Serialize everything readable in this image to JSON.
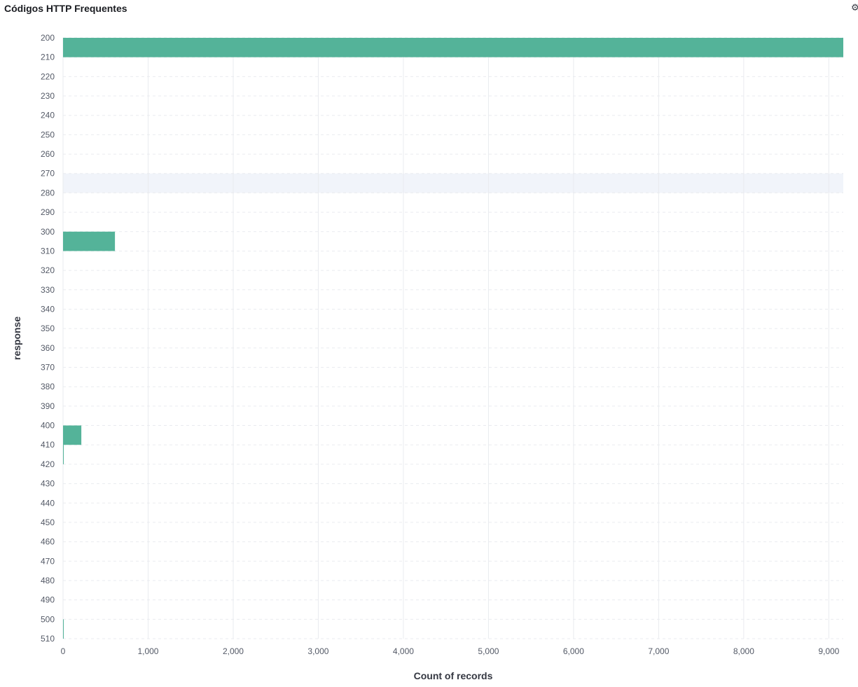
{
  "panel": {
    "title": "Códigos HTTP Frequentes",
    "corner_icon": "gear-icon",
    "corner_glyph": "⚙"
  },
  "chart_data": {
    "type": "bar",
    "orientation": "horizontal",
    "title": "Códigos HTTP Frequentes",
    "xlabel": "Count of records",
    "ylabel": "response",
    "xlim": [
      0,
      9170
    ],
    "ylim": [
      200,
      510
    ],
    "x_ticks": [
      0,
      1000,
      2000,
      3000,
      4000,
      5000,
      6000,
      7000,
      8000,
      9000
    ],
    "x_tick_labels": [
      "0",
      "1,000",
      "2,000",
      "3,000",
      "4,000",
      "5,000",
      "6,000",
      "7,000",
      "8,000",
      "9,000"
    ],
    "y_ticks": [
      200,
      210,
      220,
      230,
      240,
      250,
      260,
      270,
      280,
      290,
      300,
      310,
      320,
      330,
      340,
      350,
      360,
      370,
      380,
      390,
      400,
      410,
      420,
      430,
      440,
      450,
      460,
      470,
      480,
      490,
      500,
      510
    ],
    "bin_width": 10,
    "bars": [
      {
        "response": 200,
        "count": 9170
      },
      {
        "response": 300,
        "count": 610
      },
      {
        "response": 400,
        "count": 215
      },
      {
        "response": 410,
        "count": 5
      },
      {
        "response": 500,
        "count": 5
      }
    ],
    "highlight_band": [
      270,
      280
    ],
    "grid": true,
    "bar_color": "#54b399",
    "highlight_color": "#f1f4fa",
    "grid_color": "#e9ebef"
  }
}
